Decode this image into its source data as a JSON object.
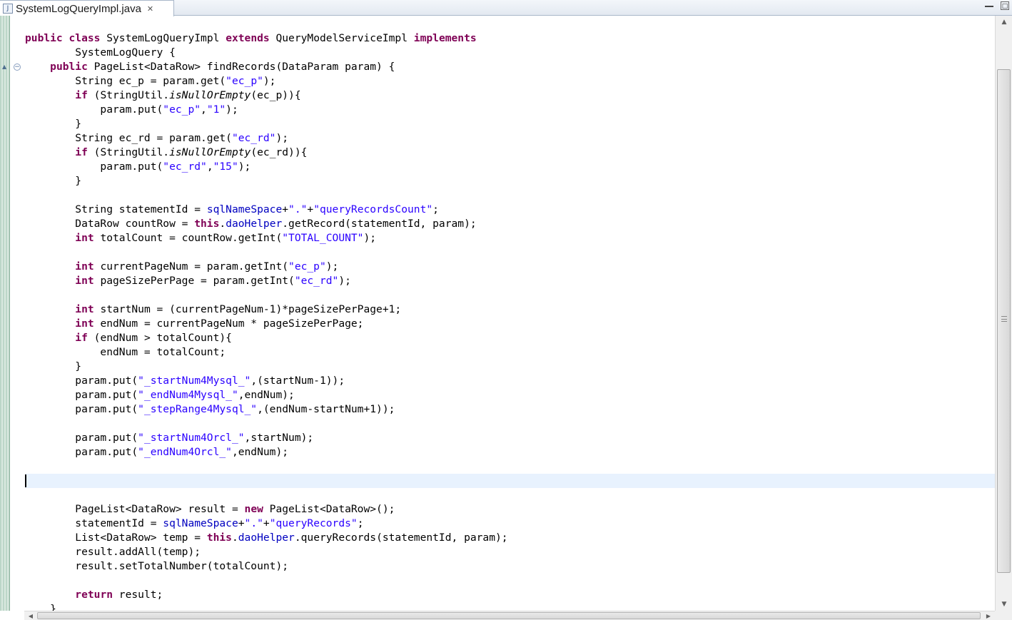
{
  "tab": {
    "title": "SystemLogQueryImpl.java",
    "icon": "java-file-icon",
    "close_glyph": "✕"
  },
  "window_controls": {
    "minimize": "",
    "maximize": "□"
  },
  "colors": {
    "keyword": "#7f0055",
    "string": "#2a00ff",
    "field": "#0000c0",
    "current_line": "#e8f2fe"
  },
  "code": {
    "current_line_index": 31,
    "lines": [
      [
        {
          "t": "public",
          "c": "kw"
        },
        {
          "t": " "
        },
        {
          "t": "class",
          "c": "kw"
        },
        {
          "t": " SystemLogQueryImpl "
        },
        {
          "t": "extends",
          "c": "kw"
        },
        {
          "t": " QueryModelServiceImpl "
        },
        {
          "t": "implements",
          "c": "kw"
        }
      ],
      [
        {
          "t": "        SystemLogQuery {"
        }
      ],
      [
        {
          "t": "    "
        },
        {
          "t": "public",
          "c": "kw"
        },
        {
          "t": " PageList<DataRow> findRecords(DataParam param) {"
        }
      ],
      [
        {
          "t": "        String ec_p = param.get("
        },
        {
          "t": "\"ec_p\"",
          "c": "str"
        },
        {
          "t": ");"
        }
      ],
      [
        {
          "t": "        "
        },
        {
          "t": "if",
          "c": "kw"
        },
        {
          "t": " (StringUtil."
        },
        {
          "t": "isNullOrEmpty",
          "c": "it"
        },
        {
          "t": "(ec_p)){"
        }
      ],
      [
        {
          "t": "            param.put("
        },
        {
          "t": "\"ec_p\"",
          "c": "str"
        },
        {
          "t": ","
        },
        {
          "t": "\"1\"",
          "c": "str"
        },
        {
          "t": ");"
        }
      ],
      [
        {
          "t": "        }"
        }
      ],
      [
        {
          "t": "        String ec_rd = param.get("
        },
        {
          "t": "\"ec_rd\"",
          "c": "str"
        },
        {
          "t": ");"
        }
      ],
      [
        {
          "t": "        "
        },
        {
          "t": "if",
          "c": "kw"
        },
        {
          "t": " (StringUtil."
        },
        {
          "t": "isNullOrEmpty",
          "c": "it"
        },
        {
          "t": "(ec_rd)){"
        }
      ],
      [
        {
          "t": "            param.put("
        },
        {
          "t": "\"ec_rd\"",
          "c": "str"
        },
        {
          "t": ","
        },
        {
          "t": "\"15\"",
          "c": "str"
        },
        {
          "t": ");"
        }
      ],
      [
        {
          "t": "        }"
        }
      ],
      [],
      [
        {
          "t": "        String statementId = "
        },
        {
          "t": "sqlNameSpace",
          "c": "fld"
        },
        {
          "t": "+"
        },
        {
          "t": "\".\"",
          "c": "str"
        },
        {
          "t": "+"
        },
        {
          "t": "\"queryRecordsCount\"",
          "c": "str"
        },
        {
          "t": ";"
        }
      ],
      [
        {
          "t": "        DataRow countRow = "
        },
        {
          "t": "this",
          "c": "kw"
        },
        {
          "t": "."
        },
        {
          "t": "daoHelper",
          "c": "fld"
        },
        {
          "t": ".getRecord(statementId, param);"
        }
      ],
      [
        {
          "t": "        "
        },
        {
          "t": "int",
          "c": "kw"
        },
        {
          "t": " totalCount = countRow.getInt("
        },
        {
          "t": "\"TOTAL_COUNT\"",
          "c": "str"
        },
        {
          "t": ");"
        }
      ],
      [],
      [
        {
          "t": "        "
        },
        {
          "t": "int",
          "c": "kw"
        },
        {
          "t": " currentPageNum = param.getInt("
        },
        {
          "t": "\"ec_p\"",
          "c": "str"
        },
        {
          "t": ");"
        }
      ],
      [
        {
          "t": "        "
        },
        {
          "t": "int",
          "c": "kw"
        },
        {
          "t": " pageSizePerPage = param.getInt("
        },
        {
          "t": "\"ec_rd\"",
          "c": "str"
        },
        {
          "t": ");"
        }
      ],
      [],
      [
        {
          "t": "        "
        },
        {
          "t": "int",
          "c": "kw"
        },
        {
          "t": " startNum = (currentPageNum-1)*pageSizePerPage+1;"
        }
      ],
      [
        {
          "t": "        "
        },
        {
          "t": "int",
          "c": "kw"
        },
        {
          "t": " endNum = currentPageNum * pageSizePerPage;"
        }
      ],
      [
        {
          "t": "        "
        },
        {
          "t": "if",
          "c": "kw"
        },
        {
          "t": " (endNum > totalCount){"
        }
      ],
      [
        {
          "t": "            endNum = totalCount;"
        }
      ],
      [
        {
          "t": "        }"
        }
      ],
      [
        {
          "t": "        param.put("
        },
        {
          "t": "\"_startNum4Mysql_\"",
          "c": "str"
        },
        {
          "t": ",(startNum-1));"
        }
      ],
      [
        {
          "t": "        param.put("
        },
        {
          "t": "\"_endNum4Mysql_\"",
          "c": "str"
        },
        {
          "t": ",endNum);"
        }
      ],
      [
        {
          "t": "        param.put("
        },
        {
          "t": "\"_stepRange4Mysql_\"",
          "c": "str"
        },
        {
          "t": ",(endNum-startNum+1));"
        }
      ],
      [],
      [
        {
          "t": "        param.put("
        },
        {
          "t": "\"_startNum4Orcl_\"",
          "c": "str"
        },
        {
          "t": ",startNum);"
        }
      ],
      [
        {
          "t": "        param.put("
        },
        {
          "t": "\"_endNum4Orcl_\"",
          "c": "str"
        },
        {
          "t": ",endNum);"
        }
      ],
      [],
      [],
      [],
      [
        {
          "t": "        PageList<DataRow> result = "
        },
        {
          "t": "new",
          "c": "kw"
        },
        {
          "t": " PageList<DataRow>();"
        }
      ],
      [
        {
          "t": "        statementId = "
        },
        {
          "t": "sqlNameSpace",
          "c": "fld"
        },
        {
          "t": "+"
        },
        {
          "t": "\".\"",
          "c": "str"
        },
        {
          "t": "+"
        },
        {
          "t": "\"queryRecords\"",
          "c": "str"
        },
        {
          "t": ";"
        }
      ],
      [
        {
          "t": "        List<DataRow> temp = "
        },
        {
          "t": "this",
          "c": "kw"
        },
        {
          "t": "."
        },
        {
          "t": "daoHelper",
          "c": "fld"
        },
        {
          "t": ".queryRecords(statementId, param);"
        }
      ],
      [
        {
          "t": "        result.addAll(temp);"
        }
      ],
      [
        {
          "t": "        result.setTotalNumber(totalCount);"
        }
      ],
      [],
      [
        {
          "t": "        "
        },
        {
          "t": "return",
          "c": "kw"
        },
        {
          "t": " result;"
        }
      ],
      [
        {
          "t": "    }"
        }
      ],
      [
        {
          "t": "}"
        }
      ]
    ]
  },
  "scrollbars": {
    "vertical": {
      "up": "▲",
      "down": "▼"
    },
    "horizontal": {
      "left": "◀",
      "right": "▶"
    }
  }
}
